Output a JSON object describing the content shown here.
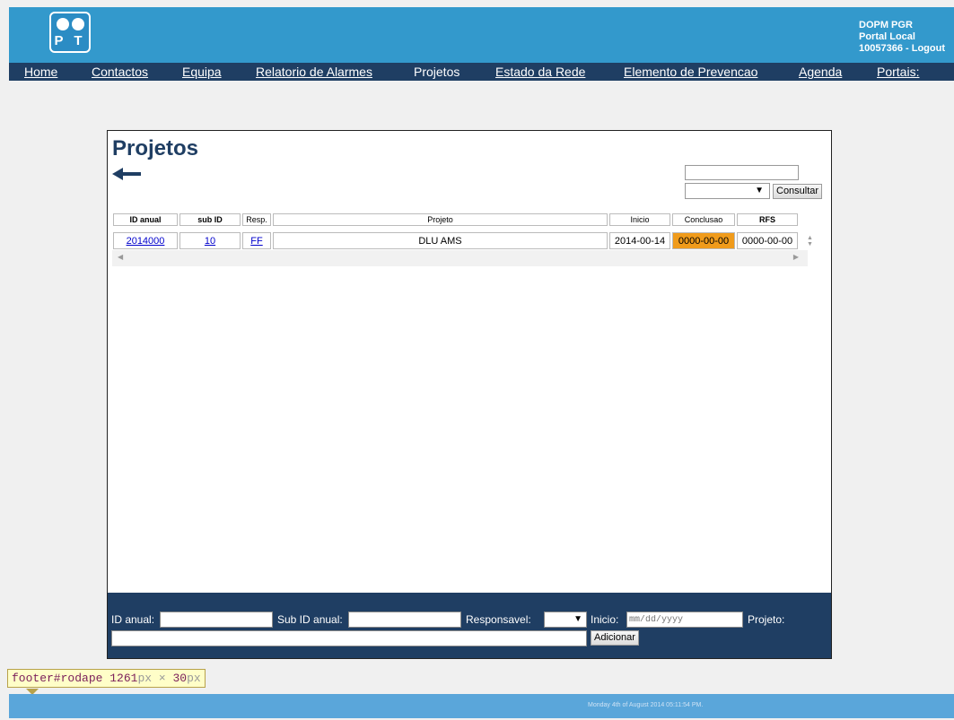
{
  "header": {
    "logo_text": "P T",
    "user_line1": "DOPM PGR",
    "user_line2": "Portal Local",
    "user_id": "10057366",
    "logout_sep": " - ",
    "logout": "Logout"
  },
  "nav": [
    {
      "label": "Home"
    },
    {
      "label": "Contactos"
    },
    {
      "label": "Equipa"
    },
    {
      "label": "Relatorio de Alarmes"
    },
    {
      "label": "Projetos"
    },
    {
      "label": "Estado da Rede"
    },
    {
      "label": "Elemento de Prevencao"
    },
    {
      "label": "Agenda"
    },
    {
      "label": "Portais:"
    }
  ],
  "page": {
    "title": "Projetos",
    "search_value": "",
    "select_value": "",
    "consultar_label": "Consultar"
  },
  "table": {
    "columns": [
      "ID anual",
      "sub ID",
      "Resp.",
      "Projeto",
      "Inicio",
      "Conclusao",
      "RFS"
    ],
    "rows": [
      {
        "id_anual": "2014000",
        "sub_id": "10",
        "resp": "FF",
        "projeto": "DLU AMS",
        "inicio": "2014-00-14",
        "conclusao": "0000-00-00",
        "rfs": "0000-00-00"
      }
    ]
  },
  "form": {
    "id_anual_label": "ID anual:",
    "sub_id_label": "Sub ID anual:",
    "responsavel_label": "Responsavel:",
    "inicio_label": "Inicio:",
    "inicio_placeholder": "mm/dd/yyyy",
    "projeto_label": "Projeto:",
    "adicionar_label": "Adicionar"
  },
  "devtools_tooltip": {
    "selector": "footer#rodape",
    "w": "1261",
    "px1": "px",
    "times": " × ",
    "h": "30",
    "px2": "px"
  },
  "footer": {
    "date_text": "Monday 4th of August 2014 05:11:54 PM."
  },
  "colors": {
    "header_blue": "#3399cc",
    "nav_navy": "#1f3e63",
    "conclusao_orange": "#f09b1b",
    "footer_blue": "#5aa6da"
  }
}
